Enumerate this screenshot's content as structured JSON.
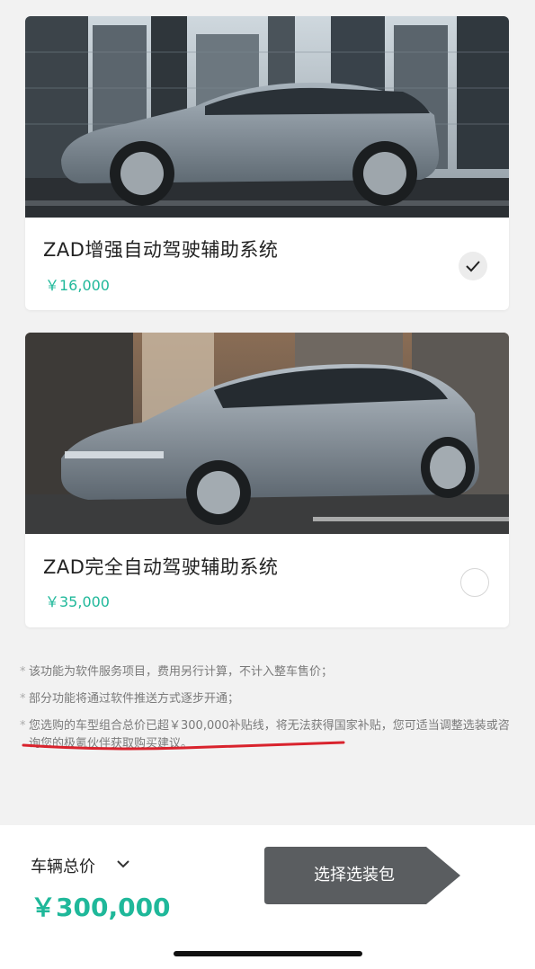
{
  "packages": [
    {
      "title": "ZAD增强自动驾驶辅助系统",
      "price": "￥16,000",
      "selected": true,
      "image": "car-side-image"
    },
    {
      "title": "ZAD完全自动驾驶辅助系统",
      "price": "￥35,000",
      "selected": false,
      "image": "car-front-image"
    }
  ],
  "notes": [
    "该功能为软件服务项目，费用另行计算，不计入整车售价；",
    "部分功能将通过软件推送方式逐步开通；",
    "您选购的车型组合总价已超￥300,000补贴线，将无法获得国家补贴，您可适当调整选装或咨询您的极氪伙伴获取购买建议。"
  ],
  "bullet": "*",
  "bottom": {
    "total_label": "车辆总价",
    "total_price": "￥300,000",
    "button_label": "选择选装包"
  },
  "colors": {
    "accent": "#1fb89a",
    "button": "#5a5d60",
    "highlight_line": "#d9232d"
  }
}
